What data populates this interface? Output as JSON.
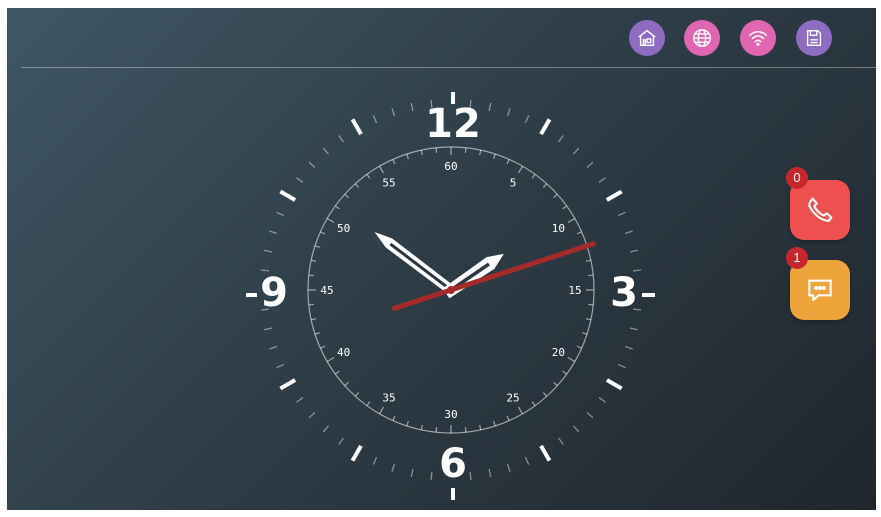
{
  "status_bar": {
    "icons": [
      {
        "name": "home-icon",
        "color": "#8d6cc2"
      },
      {
        "name": "globe-icon",
        "color": "#e166b1"
      },
      {
        "name": "wifi-icon",
        "color": "#e166b1"
      },
      {
        "name": "save-icon",
        "color": "#8d6cc2"
      }
    ]
  },
  "clock": {
    "hour_numerals": {
      "n12": "12",
      "n3": "3",
      "n6": "6",
      "n9": "9"
    },
    "minute_labels": [
      "60",
      "5",
      "10",
      "15",
      "20",
      "25",
      "30",
      "35",
      "40",
      "45",
      "50",
      "55"
    ],
    "time": {
      "hours": 1,
      "minutes": 51,
      "seconds": 12
    },
    "second_hand_color": "#a52a2a"
  },
  "actions": {
    "call": {
      "badge": "0",
      "color": "#ee4f4f",
      "icon": "phone-icon"
    },
    "message": {
      "badge": "1",
      "color": "#eda43a",
      "icon": "message-icon"
    }
  }
}
